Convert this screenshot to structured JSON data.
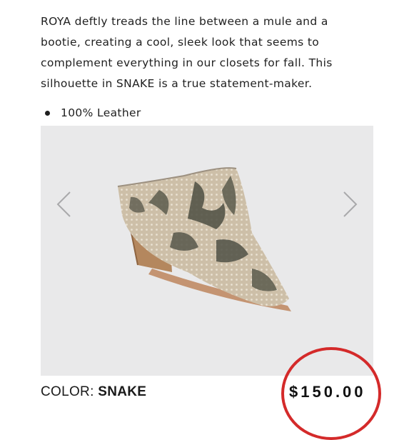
{
  "product": {
    "description_lines": [
      "ROYA deftly treads the line between a mule and a",
      "bootie, creating a cool, sleek look that seems to",
      "complement everything in our closets for fall. This",
      "silhouette in SNAKE is a true statement-maker."
    ],
    "features": [
      "100% Leather"
    ],
    "color_label": "COLOR:",
    "color_value": "SNAKE",
    "price": "$150.00"
  },
  "gallery": {
    "prev_icon": "chevron-left-icon",
    "next_icon": "chevron-right-icon",
    "image": "snakeskin-mule-shoe"
  },
  "colors": {
    "gallery_bg": "#e9e9ea",
    "annotation_circle": "#d42a2a"
  }
}
